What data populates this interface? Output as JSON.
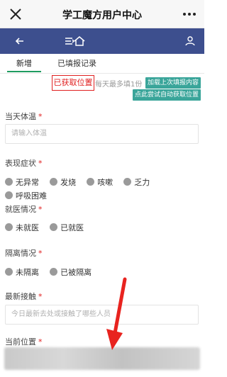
{
  "window": {
    "title": "学工魔方用户中心"
  },
  "tabs": [
    {
      "label": "新增"
    },
    {
      "label": "已填报记录"
    }
  ],
  "location_status": "已获取位置",
  "daily_limit": "每天最多填1份",
  "buttons": {
    "load_last": "加载上次填报内容",
    "auto_locate": "点此尝试自动获取位置"
  },
  "fields": {
    "temperature": {
      "label": "当天体温",
      "placeholder": "请输入体温"
    },
    "symptoms": {
      "label": "表现症状",
      "options": [
        "无异常",
        "发烧",
        "咳嗽",
        "乏力",
        "呼吸困难"
      ]
    },
    "medical": {
      "label": "就医情况",
      "options": [
        "未就医",
        "已就医"
      ]
    },
    "isolation": {
      "label": "隔离情况",
      "options": [
        "未隔离",
        "已被隔离"
      ]
    },
    "contact": {
      "label": "最新接触",
      "placeholder": "今日最新去处或接触了哪些人员"
    },
    "location": {
      "label": "当前位置"
    }
  },
  "required_mark": "*",
  "colors": {
    "nav": "#3d4f8e",
    "accent": "#1f9c61",
    "green_button": "#3aa59a",
    "highlight": "#e02020"
  },
  "icons": [
    "close-icon",
    "more-icon",
    "back-icon",
    "menu-icon",
    "home-icon",
    "user-icon"
  ]
}
